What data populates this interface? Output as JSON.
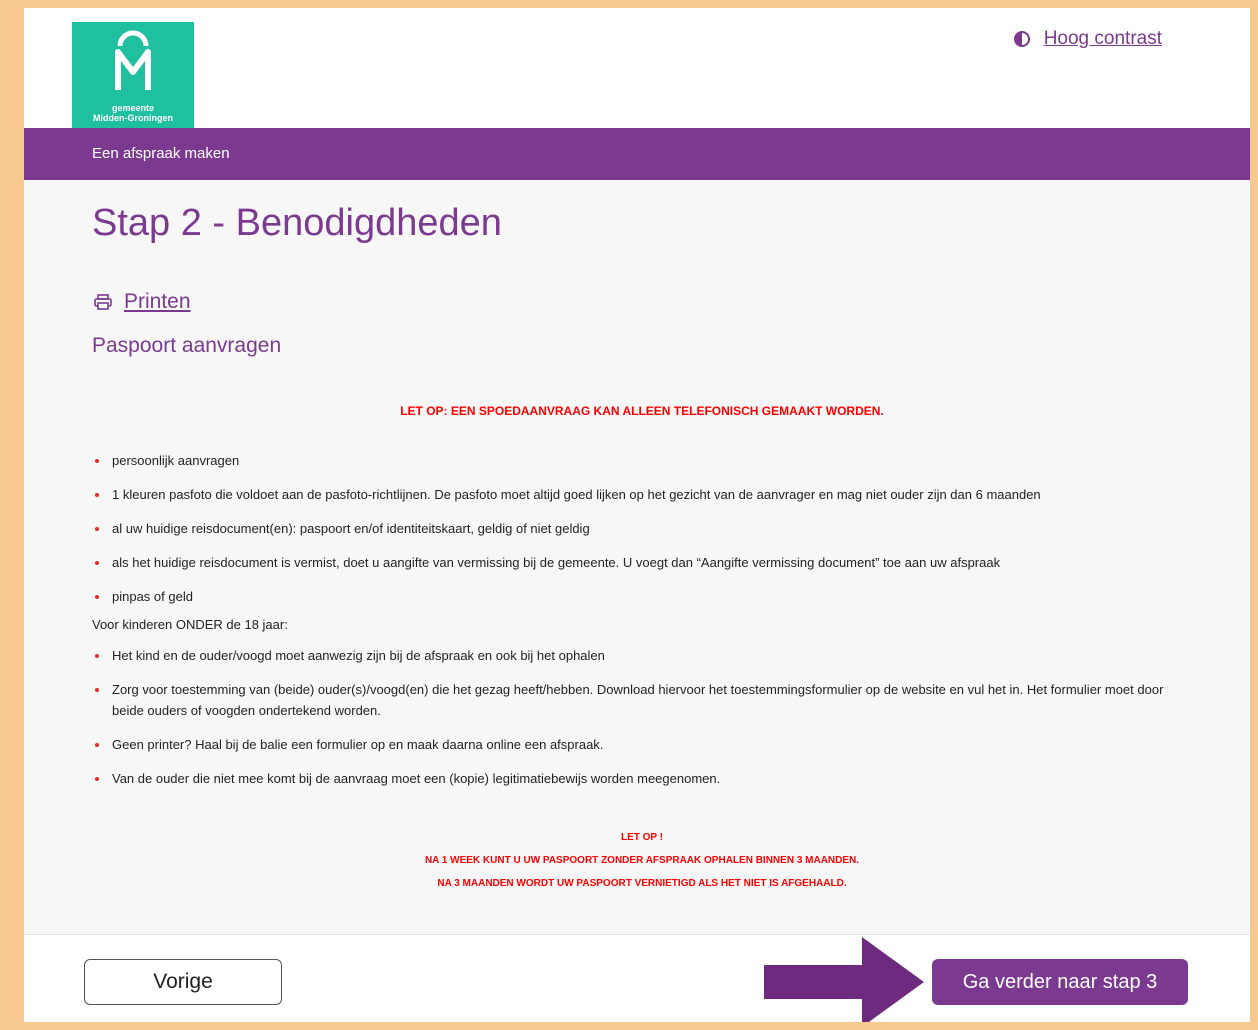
{
  "logo": {
    "line1": "gemeente",
    "line2": "Midden-Groningen"
  },
  "header": {
    "contrast_label": "Hoog contrast"
  },
  "nav": {
    "title": "Een afspraak maken"
  },
  "page": {
    "title": "Stap 2 - Benodigdheden",
    "print_label": "Printen",
    "subtitle": "Paspoort aanvragen",
    "warning": "LET OP: EEN SPOEDAANVRAAG KAN ALLEEN TELEFONISCH GEMAAKT WORDEN.",
    "items": [
      "persoonlijk aanvragen",
      "1 kleuren pasfoto die voldoet aan de pasfoto-richtlijnen. De pasfoto moet altijd goed lijken op het gezicht van de aanvrager en mag niet ouder zijn dan 6 maanden",
      "al uw huidige reisdocument(en): paspoort en/of identiteitskaart, geldig of niet geldig",
      "als het huidige reisdocument is vermist, doet u aangifte van vermissing bij de gemeente. U voegt dan “Aangifte vermissing document” toe aan uw afspraak",
      "pinpas of geld"
    ],
    "kids_heading": "Voor kinderen ONDER de 18 jaar:",
    "kids_items": [
      "Het kind en de ouder/voogd moet aanwezig zijn bij de afspraak en ook bij het ophalen",
      "Zorg voor toestemming van (beide) ouder(s)/voogd(en) die het gezag heeft/hebben. Download hiervoor het toestemmingsformulier op de website en vul het in. Het formulier moet door beide ouders of voogden ondertekend worden.",
      "Geen printer? Haal bij de balie een formulier op en maak daarna online een afspraak.",
      "Van de ouder die niet mee komt bij de aanvraag moet een (kopie) legitimatiebewijs worden meegenomen."
    ],
    "notice": [
      "LET OP !",
      "NA 1 WEEK KUNT U UW PASPOORT ZONDER AFSPRAAK OPHALEN BINNEN 3 MAANDEN.",
      "NA 3 MAANDEN WORDT UW PASPOORT VERNIETIGD ALS HET NIET IS AFGEHAALD."
    ]
  },
  "footer": {
    "prev_label": "Vorige",
    "next_label": "Ga verder naar stap 3"
  },
  "colors": {
    "brand_purple": "#7b3a8f",
    "logo_teal": "#1ec0a0",
    "warning_red": "#ff0000",
    "border_bg": "#f7c98f"
  },
  "icons": [
    "contrast-icon",
    "printer-icon",
    "arrow-icon"
  ]
}
